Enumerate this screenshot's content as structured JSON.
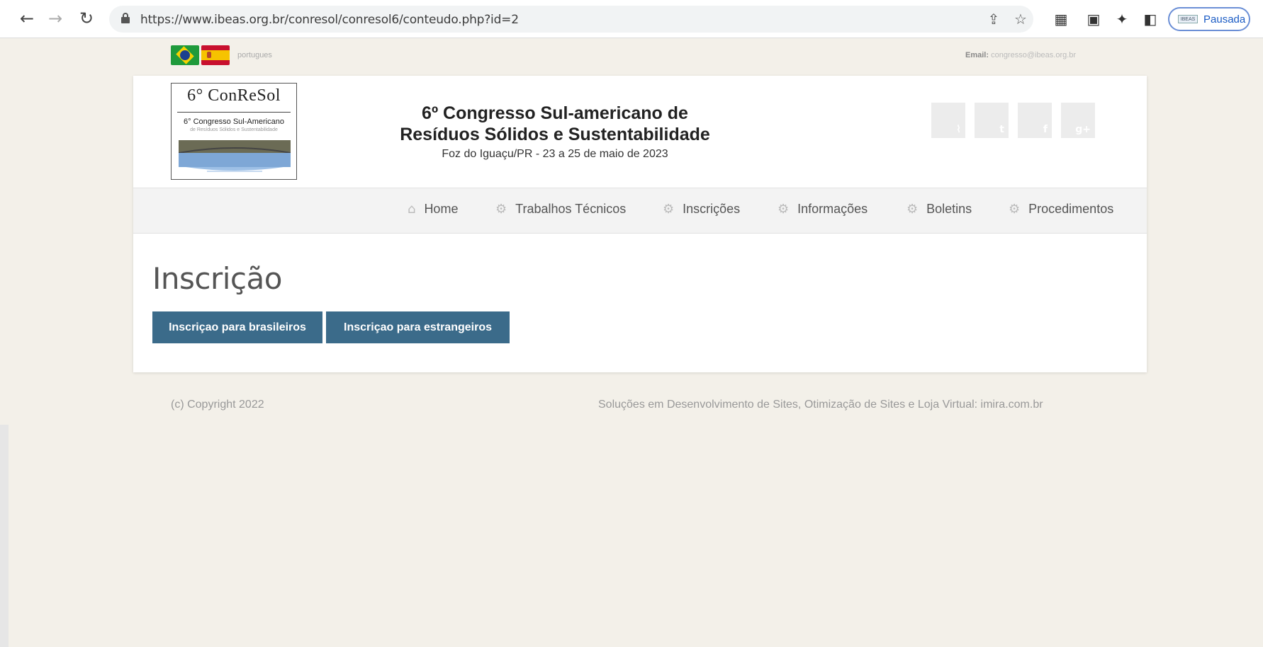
{
  "browser": {
    "url": "https://www.ibeas.org.br/conresol/conresol6/conteudo.php?id=2",
    "profile_label": "Pausada",
    "profile_avatar_text": "IBEAS"
  },
  "topbar": {
    "language_label": "portugues",
    "email_label": "Email:",
    "email_value": "congresso@ibeas.org.br"
  },
  "logo": {
    "line1": "6° ConReSol",
    "line2": "6° Congresso Sul-Americano",
    "line3": "de Resíduos Sólidos e Sustentabilidade"
  },
  "header": {
    "title": "6º Congresso Sul-americano de Resíduos Sólidos e Sustentabilidade",
    "subtitle": "Foz do Iguaçu/PR - 23 a 25 de maio de 2023"
  },
  "social": [
    "rss-icon",
    "twitter-icon",
    "facebook-icon",
    "googleplus-icon"
  ],
  "menu": [
    {
      "label": "Home",
      "icon": "home-icon"
    },
    {
      "label": "Trabalhos Técnicos",
      "icon": "gears-icon"
    },
    {
      "label": "Inscrições",
      "icon": "gears-icon"
    },
    {
      "label": "Informações",
      "icon": "gears-icon"
    },
    {
      "label": "Boletins",
      "icon": "gears-icon"
    },
    {
      "label": "Procedimentos",
      "icon": "gears-icon"
    }
  ],
  "main": {
    "heading": "Inscrição",
    "buttons": [
      "Inscriçao para brasileiros",
      "Inscriçao para estrangeiros"
    ]
  },
  "footer": {
    "copyright": "(c) Copyright 2022",
    "credits": "Soluções em Desenvolvimento de Sites, Otimização de Sites e Loja Virtual: imira.com.br"
  },
  "colors": {
    "page_bg": "#f3f0e9",
    "button_bg": "#3b6b8a",
    "menu_bg": "#f3f3f3"
  }
}
